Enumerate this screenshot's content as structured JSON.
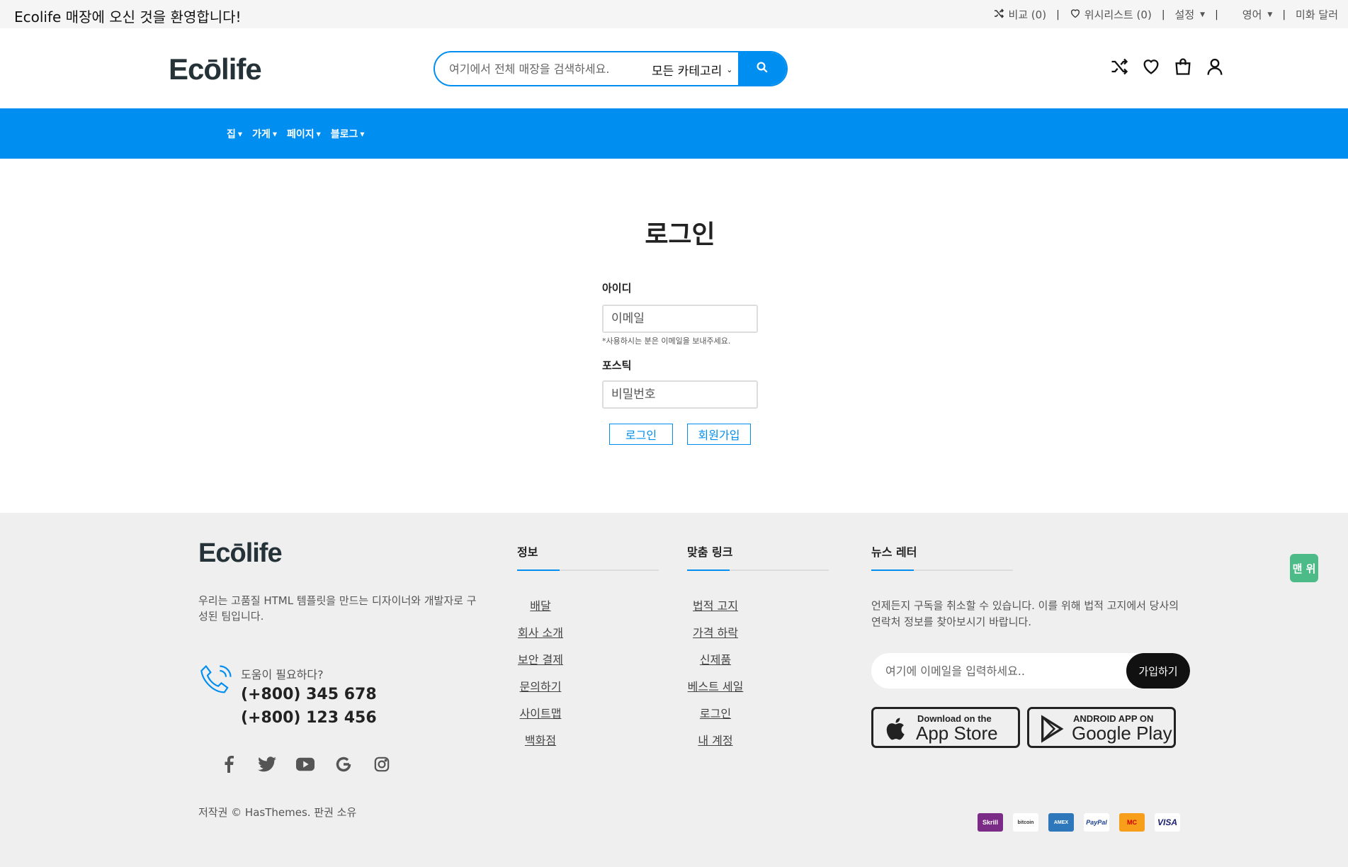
{
  "topbar": {
    "welcome": "Ecolife 매장에 오신 것을 환영합니다!",
    "compare": "비교 (0)",
    "wishlist": "위시리스트 (0)",
    "settings": "설정",
    "language": "영어",
    "currency": "미화 달러"
  },
  "header": {
    "logo": "Ecōlife",
    "search_placeholder": "여기에서 전체 매장을 검색하세요.",
    "category": "모든 카테고리"
  },
  "nav": {
    "items": [
      "집",
      "가게",
      "페이지",
      "블로그"
    ]
  },
  "login": {
    "title": "로그인",
    "id_label": "아이디",
    "email_placeholder": "이메일",
    "email_hint": "*사용하시는 분은 이메일을 보내주세요.",
    "password_label": "포스틱",
    "password_placeholder": "비밀번호",
    "login_button": "로그인",
    "signup_button": "회원가입"
  },
  "footer": {
    "logo": "Ecōlife",
    "about": "우리는 고품질 HTML 템플릿을 만드는 디자이너와 개발자로 구성된 팀입니다.",
    "help": "도움이 필요하다?",
    "phone1": "(+800) 345 678",
    "phone2": "(+800) 123 456",
    "copyright": "저작권 © HasThemes. 판권 소유",
    "info_title": "정보",
    "info_links": [
      "배달",
      "회사 소개",
      "보안 결제",
      "문의하기",
      "사이트맵",
      "백화점"
    ],
    "custom_title": "맞춤 링크",
    "custom_links": [
      "법적 고지",
      "가격 하락",
      "신제품",
      "베스트 세일",
      "로그인",
      "내 계정"
    ],
    "news_title": "뉴스 레터",
    "news_text": "언제든지 구독을 취소할 수 있습니다. 이를 위해 법적 고지에서 당사의 연락처 정보를 찾아보시기 바랍니다.",
    "news_placeholder": "여기에 이메일을 입력하세요..",
    "subscribe": "가입하기",
    "appstore_small": "Download on the",
    "appstore_big": "App Store",
    "play_small": "ANDROID APP ON",
    "play_big": "Google Play",
    "payments": [
      "Skrill",
      "bitcoin",
      "AMEX",
      "PayPal",
      "MC",
      "VISA"
    ],
    "to_top": "맨 위"
  },
  "colors": {
    "accent": "#008ef0",
    "top_button": "#4cbb87",
    "footer_bg": "#efefef"
  }
}
